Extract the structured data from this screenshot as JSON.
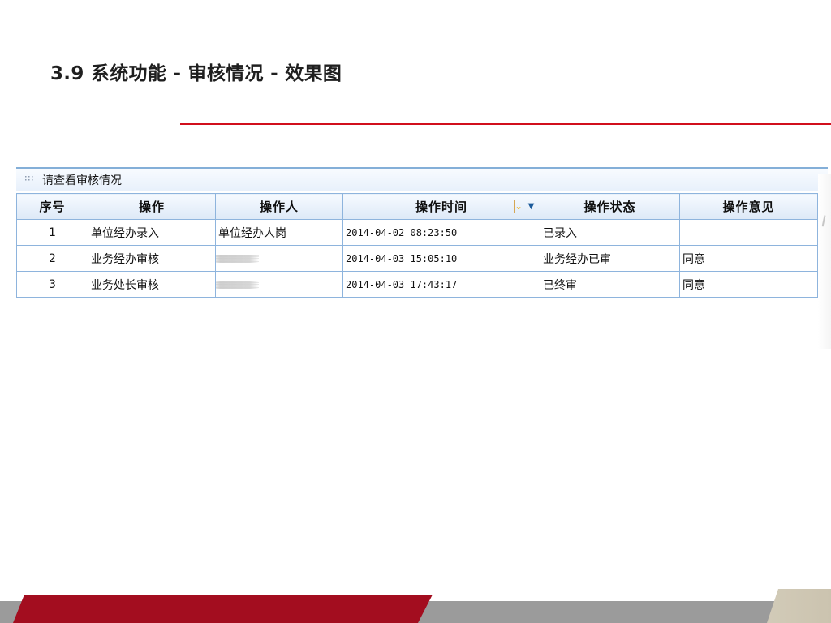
{
  "slide": {
    "title": "3.9  系统功能 - 审核情况 - 效果图"
  },
  "panel": {
    "title": "请查看审核情况",
    "columns": [
      "序号",
      "操作",
      "操作人",
      "操作时间",
      "操作状态",
      "操作意见"
    ],
    "rows": [
      {
        "index": "1",
        "operation": "单位经办录入",
        "operator": "单位经办人岗",
        "time": "2014-04-02 08:23:50",
        "status": "已录入",
        "opinion": ""
      },
      {
        "index": "2",
        "operation": "业务经办审核",
        "operator": "",
        "time": "2014-04-03 15:05:10",
        "status": "业务经办已审",
        "opinion": "同意"
      },
      {
        "index": "3",
        "operation": "业务处长审核",
        "operator": "",
        "time": "2014-04-03 17:43:17",
        "status": "已终审",
        "opinion": "同意"
      }
    ],
    "icons": {
      "header": "grip-icon",
      "sort": "sort-indicator-icon",
      "menu": "chevron-down-icon"
    }
  },
  "colors": {
    "accent_red": "#d10f1c",
    "header_border": "#84afd8",
    "grid_border": "#8eb4dd",
    "footer_red": "#a30d1f",
    "footer_gray": "#9b9b9b",
    "footer_beige": "#d2cbb8"
  }
}
